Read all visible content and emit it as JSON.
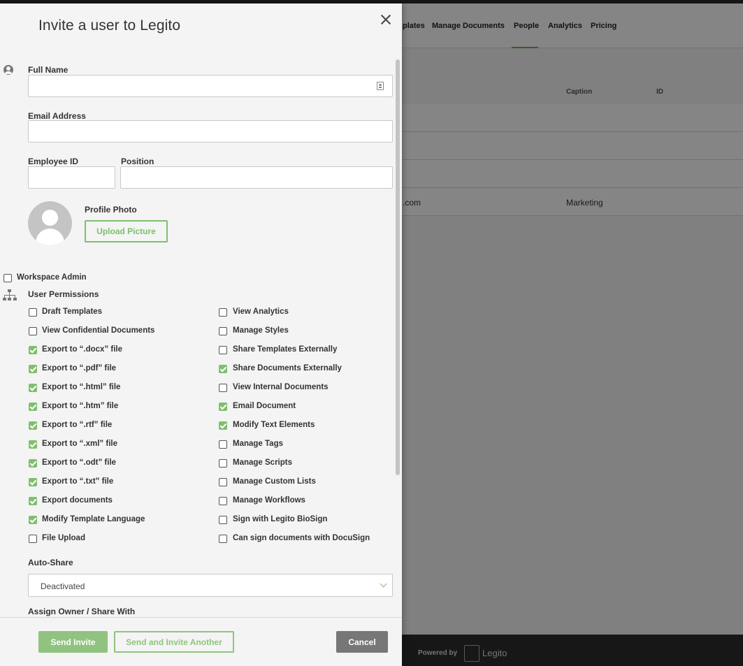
{
  "background": {
    "nav_items": [
      "plates",
      "Manage Documents",
      "People",
      "Analytics",
      "Pricing"
    ],
    "active_nav": "People",
    "column_headers": [
      "Caption",
      "ID"
    ],
    "row_values": [
      ".com",
      "Marketing"
    ],
    "footer": {
      "powered_by": "Powered by",
      "brand": "Legito"
    }
  },
  "modal": {
    "title": "Invite a user to Legito",
    "close_icon": "close-icon",
    "fields": {
      "full_name_label": "Full Name",
      "full_name_value": "",
      "email_label": "Email Address",
      "email_value": "",
      "employee_id_label": "Employee ID",
      "employee_id_value": "",
      "position_label": "Position",
      "position_value": ""
    },
    "profile_photo": {
      "label": "Profile Photo",
      "upload_button": "Upload Picture"
    },
    "workspace_admin": {
      "label": "Workspace Admin",
      "checked": false
    },
    "permissions": {
      "heading": "User Permissions",
      "left": [
        {
          "label": "Draft Templates",
          "checked": false
        },
        {
          "label": "View Confidential Documents",
          "checked": false
        },
        {
          "label": "Export to “.docx” file",
          "checked": true
        },
        {
          "label": "Export to “.pdf” file",
          "checked": true
        },
        {
          "label": "Export to “.html” file",
          "checked": true
        },
        {
          "label": "Export to “.htm” file",
          "checked": true
        },
        {
          "label": "Export to “.rtf” file",
          "checked": true
        },
        {
          "label": "Export to “.xml” file",
          "checked": true
        },
        {
          "label": "Export to “.odt” file",
          "checked": true
        },
        {
          "label": "Export to “.txt” file",
          "checked": true
        },
        {
          "label": "Export documents",
          "checked": true
        },
        {
          "label": "Modify Template Language",
          "checked": true
        },
        {
          "label": "File Upload",
          "checked": false
        }
      ],
      "right": [
        {
          "label": "View Analytics",
          "checked": false
        },
        {
          "label": "Manage Styles",
          "checked": false
        },
        {
          "label": "Share Templates Externally",
          "checked": false
        },
        {
          "label": "Share Documents Externally",
          "checked": true
        },
        {
          "label": "View Internal Documents",
          "checked": false
        },
        {
          "label": "Email Document",
          "checked": true
        },
        {
          "label": "Modify Text Elements",
          "checked": true
        },
        {
          "label": "Manage Tags",
          "checked": false
        },
        {
          "label": "Manage Scripts",
          "checked": false
        },
        {
          "label": "Manage Custom Lists",
          "checked": false
        },
        {
          "label": "Manage Workflows",
          "checked": false
        },
        {
          "label": "Sign with Legito BioSign",
          "checked": false
        },
        {
          "label": "Can sign documents with DocuSign",
          "checked": false
        }
      ]
    },
    "auto_share": {
      "label": "Auto-Share",
      "value": "Deactivated"
    },
    "assign_owner": {
      "label": "Assign Owner / Share With"
    },
    "buttons": {
      "send": "Send Invite",
      "send_another": "Send and Invite Another",
      "cancel": "Cancel"
    }
  },
  "colors": {
    "accent_green": "#7fbf6d",
    "cancel_gray": "#777777",
    "panel_bg": "#f3f4f3"
  }
}
